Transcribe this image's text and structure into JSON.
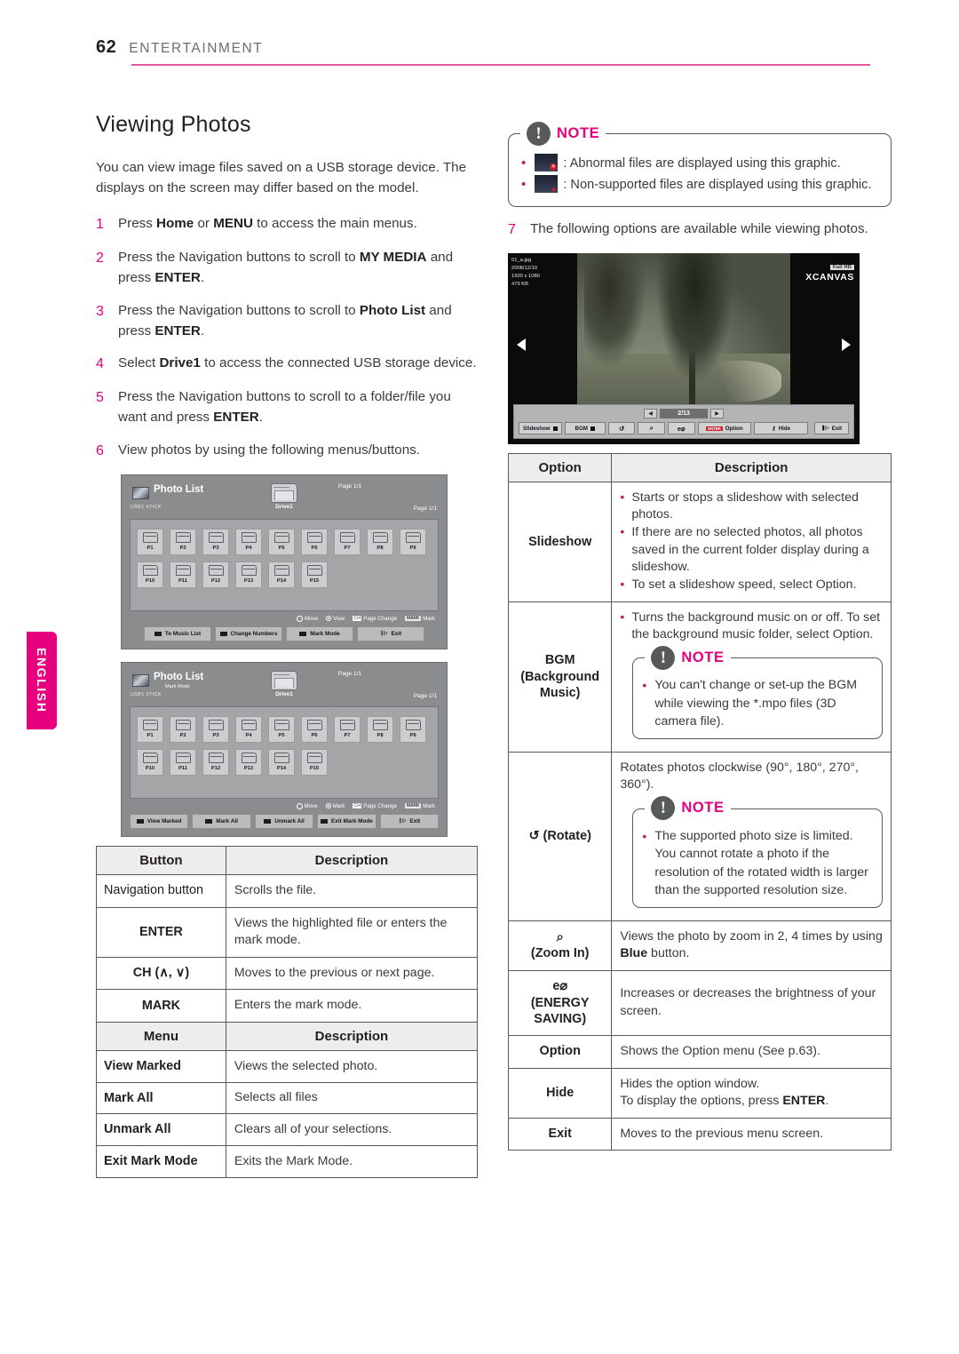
{
  "header": {
    "page_number": "62",
    "title": "ENTERTAINMENT"
  },
  "lang_tab": {
    "label": "ENGLISH"
  },
  "left": {
    "section_title": "Viewing Photos",
    "intro": "You can view image files saved on a USB storage device. The displays on the screen may differ based on the model.",
    "steps": [
      {
        "num": "1",
        "html": "Press <b>Home</b> or <b>MENU</b> to access the main menus."
      },
      {
        "num": "2",
        "html": "Press the Navigation buttons to scroll to <b>MY MEDIA</b> and press <b>ENTER</b>."
      },
      {
        "num": "3",
        "html": "Press the Navigation buttons to scroll to <b>Photo List</b> and press <b>ENTER</b>."
      },
      {
        "num": "4",
        "html": "Select <b>Drive1</b> to access the connected USB storage device."
      },
      {
        "num": "5",
        "html": "Press the Navigation buttons to scroll to a folder/file you want and press <b>ENTER</b>."
      },
      {
        "num": "6",
        "html": "View photos by using the following menus/buttons."
      }
    ]
  },
  "photo_list_1": {
    "title": "Photo List",
    "subtitle": "",
    "device": "USB1 XTICK",
    "page_top": "Page 1/1",
    "page_right": "Page 1/1",
    "drive_label": "Drive1",
    "row1": [
      "P1",
      "P2",
      "P3",
      "P4",
      "P5",
      "P6",
      "P7",
      "P8",
      "P9"
    ],
    "row2": [
      "P10",
      "P11",
      "P12",
      "P13",
      "P14",
      "P15"
    ],
    "hints": [
      "Move",
      "View",
      "Page Change",
      "Mark"
    ],
    "buttons": [
      "To Music List",
      "Change Numbers",
      "Mark Mode",
      "Exit"
    ]
  },
  "photo_list_2": {
    "title": "Photo List",
    "subtitle": "Mark Mode",
    "device": "USB1 XTICK",
    "page_top": "Page 1/1",
    "page_right": "Page 1/1",
    "drive_label": "Drive1",
    "row1": [
      "P1",
      "P2",
      "P3",
      "P4",
      "P5",
      "P6",
      "P7",
      "P8",
      "P9"
    ],
    "row2": [
      "P10",
      "P11",
      "P12",
      "P13",
      "P14",
      "P15"
    ],
    "hints": [
      "Move",
      "Mark",
      "Page Change",
      "Mark"
    ],
    "buttons": [
      "View Marked",
      "Mark All",
      "Unmark All",
      "Exit Mark Mode",
      "Exit"
    ]
  },
  "button_table": {
    "headers": {
      "col1": "Button",
      "col2": "Description"
    },
    "rows": [
      {
        "key": "Navigation button",
        "key_style": "plain",
        "value": "Scrolls the file."
      },
      {
        "key": "ENTER",
        "key_style": "bold",
        "value": "Views the highlighted file or enters the mark mode."
      },
      {
        "key": "CH (∧, ∨)",
        "key_style": "bold",
        "value": "Moves to the previous or next page."
      },
      {
        "key": "MARK",
        "key_style": "bold",
        "value": "Enters the mark mode."
      }
    ],
    "headers2": {
      "col1": "Menu",
      "col2": "Description"
    },
    "rows2": [
      {
        "key": "View Marked",
        "value": "Views the selected photo."
      },
      {
        "key": "Mark All",
        "value": "Selects all files"
      },
      {
        "key": "Unmark All",
        "value": "Clears all of your selections."
      },
      {
        "key": "Exit Mark Mode",
        "value": "Exits the Mark Mode."
      }
    ]
  },
  "right": {
    "note_top": {
      "label": "NOTE",
      "items": [
        {
          "icon": "abnormal-file-thumb",
          "text": ": Abnormal files are displayed using this graphic."
        },
        {
          "icon": "nonsupported-file-thumb",
          "text": ": Non-supported files are displayed using this graphic."
        }
      ]
    },
    "step7": {
      "num": "7",
      "text": "The following options are available while viewing photos."
    }
  },
  "viewer": {
    "file_name": "01_a.jpg",
    "file_date": "2008/12/10",
    "file_res": "1920 x 1080",
    "file_size": "479 KB",
    "badge_fullhd": "Full HD",
    "badge_brand": "XCANVAS",
    "page_indicator": "2/13",
    "buttons": [
      {
        "label": "Slideshow",
        "icon": "stop-square"
      },
      {
        "label": "BGM",
        "icon": "stop-square"
      },
      {
        "label": "",
        "icon": "rotate-icon",
        "glyph": "↺"
      },
      {
        "label": "",
        "icon": "zoom-in-icon",
        "glyph": "⌕"
      },
      {
        "label": "",
        "icon": "energy-saving-icon",
        "glyph": "e⌀"
      },
      {
        "label": "Option",
        "icon": "enter-chip",
        "chip": "ENTER"
      },
      {
        "label": "Hide",
        "icon": "hide-icon",
        "glyph": "⚷"
      },
      {
        "label": "Exit",
        "icon": "exit-icon",
        "glyph": "⏻"
      }
    ]
  },
  "option_table": {
    "headers": {
      "col1": "Option",
      "col2": "Description"
    },
    "rows": [
      {
        "key": "Slideshow",
        "bullets": [
          "Starts or stops a slideshow with selected photos.",
          "If there are no selected photos, all photos saved in the current folder display during a slideshow.",
          "To set a slideshow speed, select Option."
        ]
      },
      {
        "key": "BGM (Background Music)",
        "key_lines": [
          "BGM",
          "(Background",
          "Music)"
        ],
        "bullets": [
          "Turns the background music on or off. To set the background music folder, select Option."
        ],
        "note": {
          "label": "NOTE",
          "items": [
            "You can't change or set-up the BGM while viewing the *.mpo files (3D camera file)."
          ]
        }
      },
      {
        "key": "↺ (Rotate)",
        "text": "Rotates photos clockwise (90°, 180°, 270°, 360°).",
        "note": {
          "label": "NOTE",
          "items": [
            "The supported photo size is limited. You cannot rotate a photo if the resolution of the rotated width is larger than the supported resolution size."
          ]
        }
      },
      {
        "key_lines": [
          "⌕",
          "(Zoom In)"
        ],
        "html": "Views the photo by zoom in 2, 4 times by using <b>Blue</b> button."
      },
      {
        "key_lines": [
          "e⌀",
          "(ENERGY",
          "SAVING)"
        ],
        "text": "Increases or decreases the brightness of your screen."
      },
      {
        "key": "Option",
        "text": "Shows the Option menu (See p.63)."
      },
      {
        "key": "Hide",
        "html": "Hides the option window.<br>To display the options, press <b>ENTER</b>."
      },
      {
        "key": "Exit",
        "text": "Moves to the previous menu screen."
      }
    ]
  }
}
